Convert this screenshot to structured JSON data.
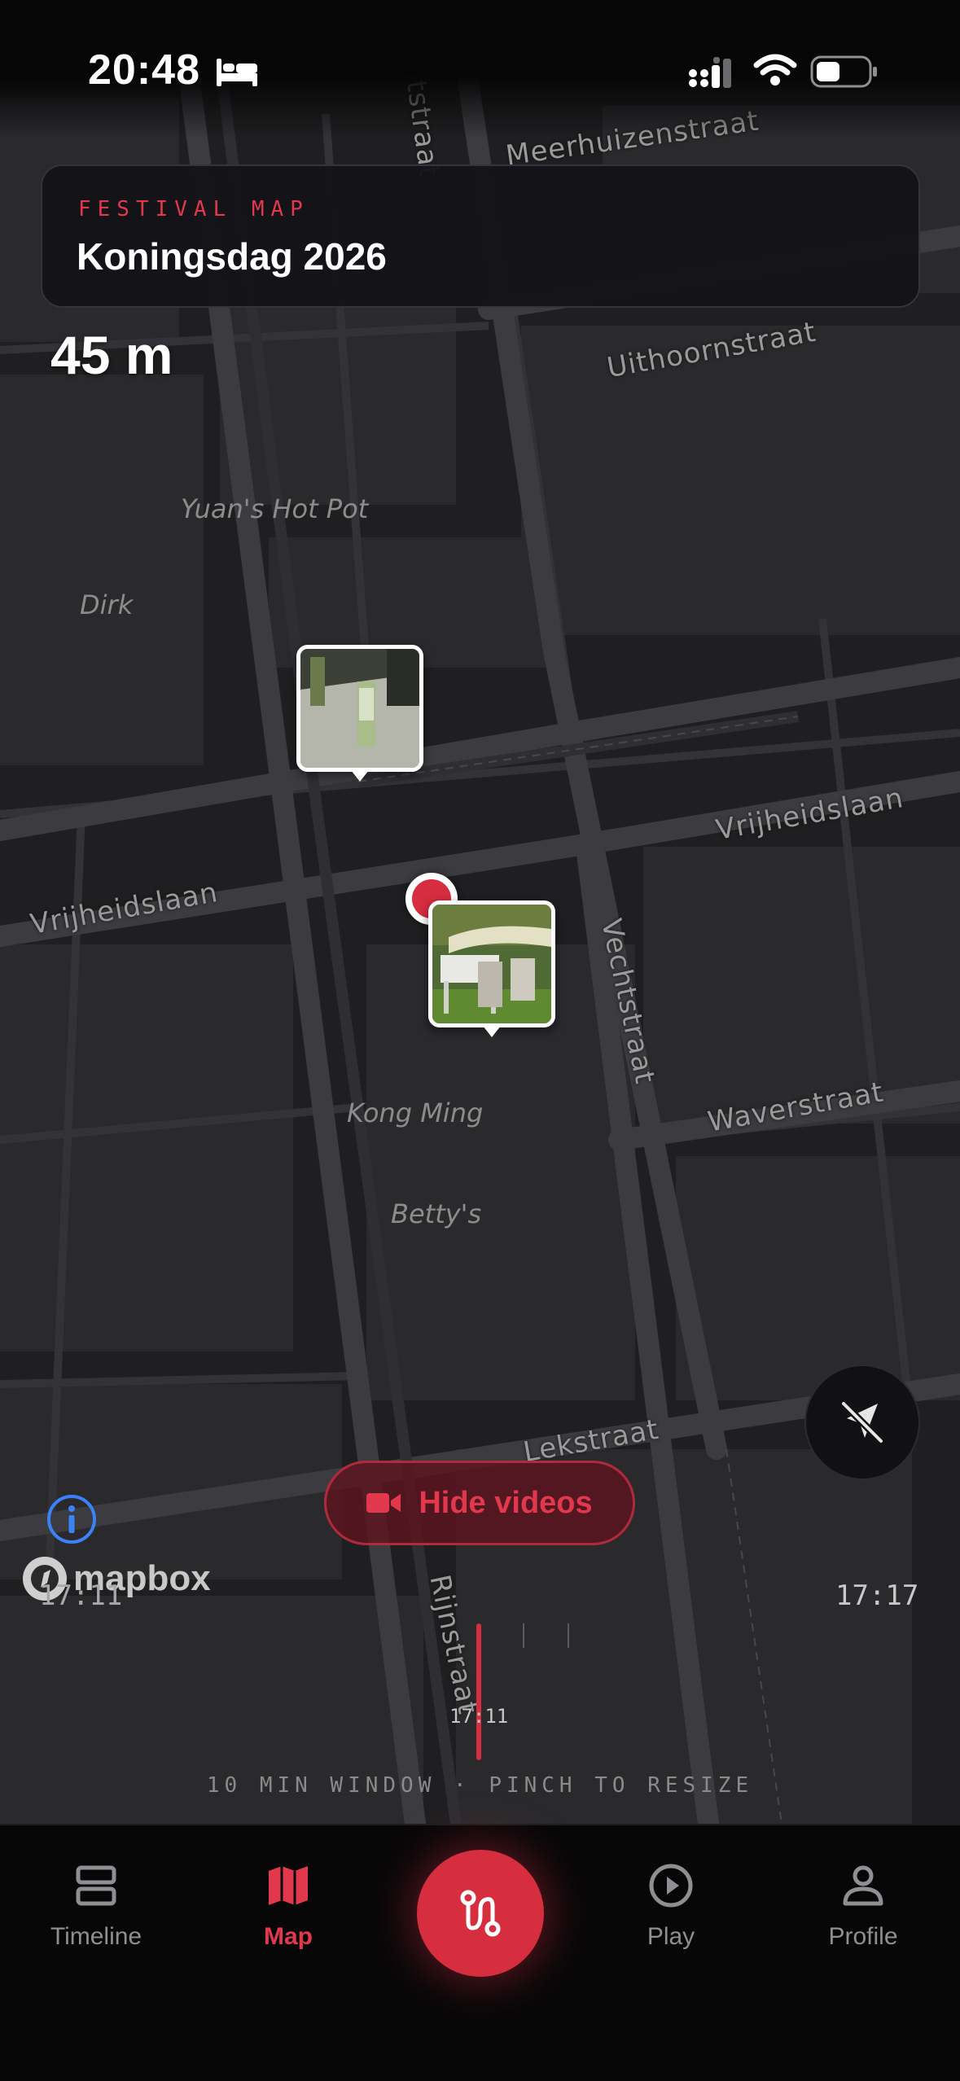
{
  "status_bar": {
    "time": "20:48"
  },
  "festival": {
    "eyebrow": "FESTIVAL MAP",
    "title": "Koningsdag 2026"
  },
  "map": {
    "scale": "45 m",
    "streets": [
      "Meerhuizenstraat",
      "Uithoornstraat",
      "Vrijheidslaan",
      "Vrijheidslaan",
      "Vechtstraat",
      "Waverstraat",
      "Lekstraat",
      "Rijnstraat",
      "Vechtstraat"
    ],
    "pois": [
      "Yuan's Hot Pot",
      "Dirk",
      "Kong Ming",
      "Betty's"
    ],
    "attribution": "mapbox"
  },
  "controls": {
    "hide_videos_label": "Hide videos"
  },
  "timeline": {
    "start": "17:11",
    "end": "17:17",
    "current": "17:11",
    "hint": "10 MIN WINDOW · PINCH TO RESIZE"
  },
  "tabs": [
    {
      "label": "Timeline",
      "icon": "timeline-icon"
    },
    {
      "label": "Map",
      "icon": "map-icon"
    },
    {
      "label": "Play",
      "icon": "play-icon"
    },
    {
      "label": "Profile",
      "icon": "profile-icon"
    }
  ],
  "colors": {
    "accent": "#e2384d",
    "map_bg": "#1f1f21",
    "street": "#3c3c40"
  }
}
